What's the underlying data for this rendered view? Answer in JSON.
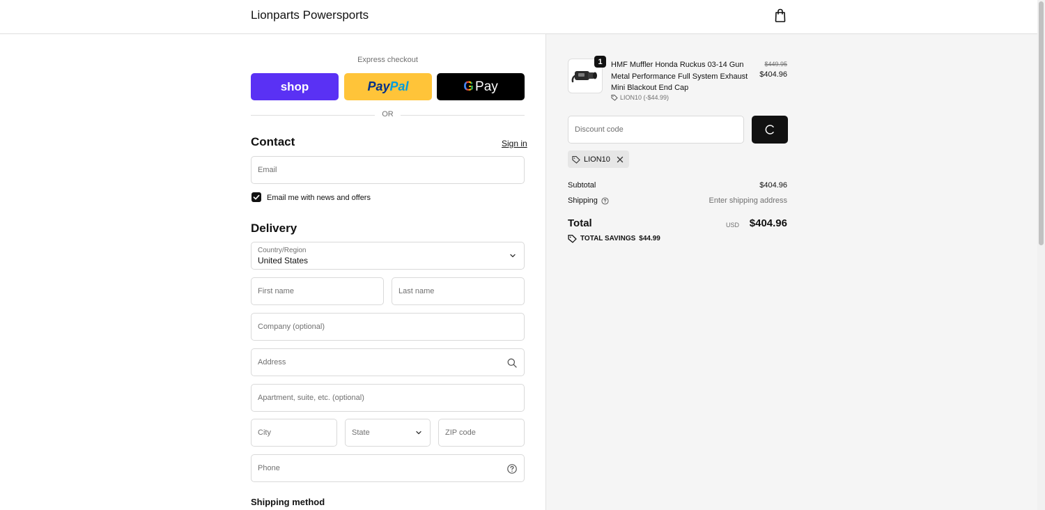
{
  "header": {
    "store_name": "Lionparts Powersports"
  },
  "express": {
    "label": "Express checkout",
    "shop_label": "shop",
    "paypal_part1": "Pay",
    "paypal_part2": "Pal",
    "gpay_g": "G",
    "gpay_label": "Pay",
    "or_label": "OR"
  },
  "contact": {
    "title": "Contact",
    "sign_in": "Sign in",
    "email_placeholder": "Email",
    "news_label": "Email me with news and offers",
    "news_checked": true
  },
  "delivery": {
    "title": "Delivery",
    "country_label": "Country/Region",
    "country_value": "United States",
    "first_name": "First name",
    "last_name": "Last name",
    "company": "Company (optional)",
    "address": "Address",
    "apartment": "Apartment, suite, etc. (optional)",
    "city": "City",
    "state": "State",
    "zip": "ZIP code",
    "phone": "Phone"
  },
  "shipping_method": {
    "title": "Shipping method"
  },
  "order": {
    "quantity": "1",
    "product_name": "HMF Muffler Honda Ruckus 03-14 Gun Metal Performance Full System Exhaust Mini Blackout End Cap",
    "product_discount": "LION10 (-$44.99)",
    "original_price": "$449.95",
    "final_price": "$404.96",
    "discount_placeholder": "Discount code",
    "applied_code": "LION10",
    "subtotal_label": "Subtotal",
    "subtotal_value": "$404.96",
    "shipping_label": "Shipping",
    "shipping_value": "Enter shipping address",
    "total_label": "Total",
    "currency": "USD",
    "total_value": "$404.96",
    "savings_label": "TOTAL SAVINGS",
    "savings_value": "$44.99"
  },
  "colors": {
    "shop": "#5a31f4",
    "paypal": "#ffc439",
    "gpay": "#000000",
    "summary_bg": "#f5f5f5"
  }
}
